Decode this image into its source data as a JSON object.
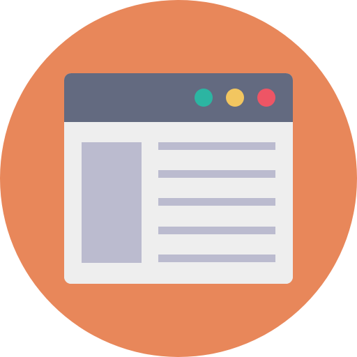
{
  "icon": {
    "name": "browser-window-icon",
    "colors": {
      "background_circle": "#E8875A",
      "window_body": "#EEEEEE",
      "titlebar": "#636A80",
      "placeholder": "#BBBBCF",
      "dot_green": "#2CB5A2",
      "dot_yellow": "#F2C660",
      "dot_red": "#EE5565"
    },
    "content_line_count": 5
  }
}
